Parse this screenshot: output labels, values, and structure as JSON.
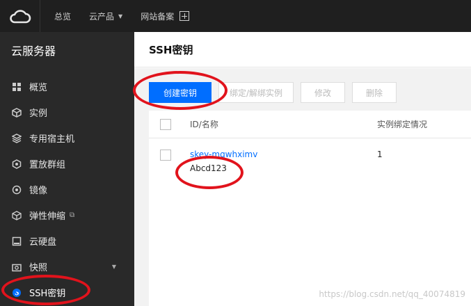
{
  "topbar": {
    "overview": "总览",
    "products": "云产品",
    "beian": "网站备案"
  },
  "sidebar": {
    "title": "云服务器",
    "items": [
      {
        "label": "概览",
        "icon": "grid-icon"
      },
      {
        "label": "实例",
        "icon": "cube-icon"
      },
      {
        "label": "专用宿主机",
        "icon": "layers-icon"
      },
      {
        "label": "置放群组",
        "icon": "hexagon-icon"
      },
      {
        "label": "镜像",
        "icon": "disc-icon"
      },
      {
        "label": "弹性伸缩",
        "icon": "box-icon"
      },
      {
        "label": "云硬盘",
        "icon": "drive-icon"
      },
      {
        "label": "快照",
        "icon": "camera-icon"
      },
      {
        "label": "SSH密钥",
        "icon": "key-icon"
      }
    ]
  },
  "main": {
    "title": "SSH密钥",
    "buttons": {
      "create": "创建密钥",
      "bind": "绑定/解绑实例",
      "edit": "修改",
      "delete": "删除"
    },
    "table": {
      "col_id": "ID/名称",
      "col_bind": "实例绑定情况",
      "rows": [
        {
          "id": "skey-mqwhximv",
          "name": "Abcd123",
          "bind": "1"
        }
      ]
    }
  },
  "watermark": "https://blog.csdn.net/qq_40074819",
  "colors": {
    "topbar": "#1f1f1f",
    "sidebar": "#292929",
    "primary": "#006eff",
    "annotation": "#e1131c"
  }
}
